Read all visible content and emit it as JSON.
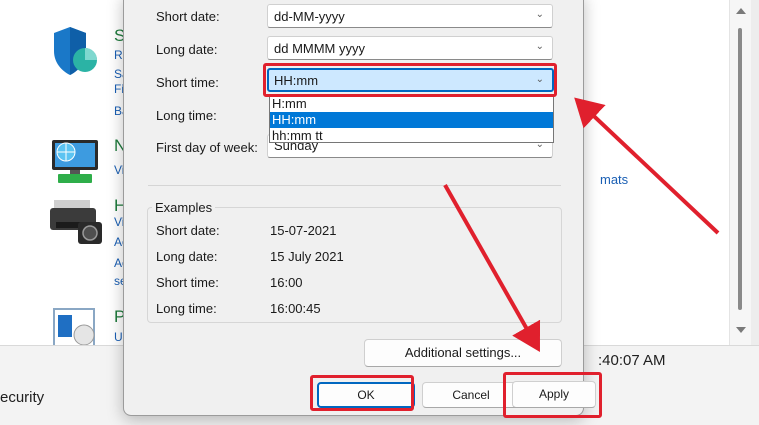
{
  "background": {
    "security_label": "ecurity",
    "clock": ":40:07 AM",
    "formats_link_fragment": "mats",
    "items": [
      {
        "title": "S",
        "subs": [
          "Re",
          "Sa",
          "Fi",
          "Ba"
        ],
        "icon": "shield-icon"
      },
      {
        "title": "N",
        "subs": [
          "Vi"
        ],
        "icon": "network-monitor-icon"
      },
      {
        "title": "H",
        "subs": [
          "Vi",
          "Ac",
          "Ac",
          "se"
        ],
        "icon": "printer-icon"
      },
      {
        "title": "P",
        "subs": [
          "Ur"
        ],
        "icon": "programs-icon"
      }
    ]
  },
  "formats": {
    "short_date": {
      "label": "Short date:",
      "value": "dd-MM-yyyy"
    },
    "long_date": {
      "label": "Long date:",
      "value": "dd MMMM yyyy"
    },
    "short_time": {
      "label": "Short time:",
      "value": "HH:mm",
      "options": [
        "H:mm",
        "HH:mm",
        "hh:mm tt"
      ],
      "selected_index": 1
    },
    "long_time": {
      "label": "Long time:"
    },
    "first_day": {
      "label": "First day of week:",
      "value": "Sunday"
    }
  },
  "examples": {
    "title": "Examples",
    "rows": [
      {
        "label": "Short date:",
        "value": "15-07-2021"
      },
      {
        "label": "Long date:",
        "value": "15 July 2021"
      },
      {
        "label": "Short time:",
        "value": "16:00"
      },
      {
        "label": "Long time:",
        "value": "16:00:45"
      }
    ]
  },
  "buttons": {
    "additional": "Additional settings...",
    "ok": "OK",
    "cancel": "Cancel",
    "apply": "Apply"
  },
  "colors": {
    "annotation_red": "#e0202d",
    "focus_blue": "#0067c0",
    "selection_blue": "#0078d7"
  }
}
